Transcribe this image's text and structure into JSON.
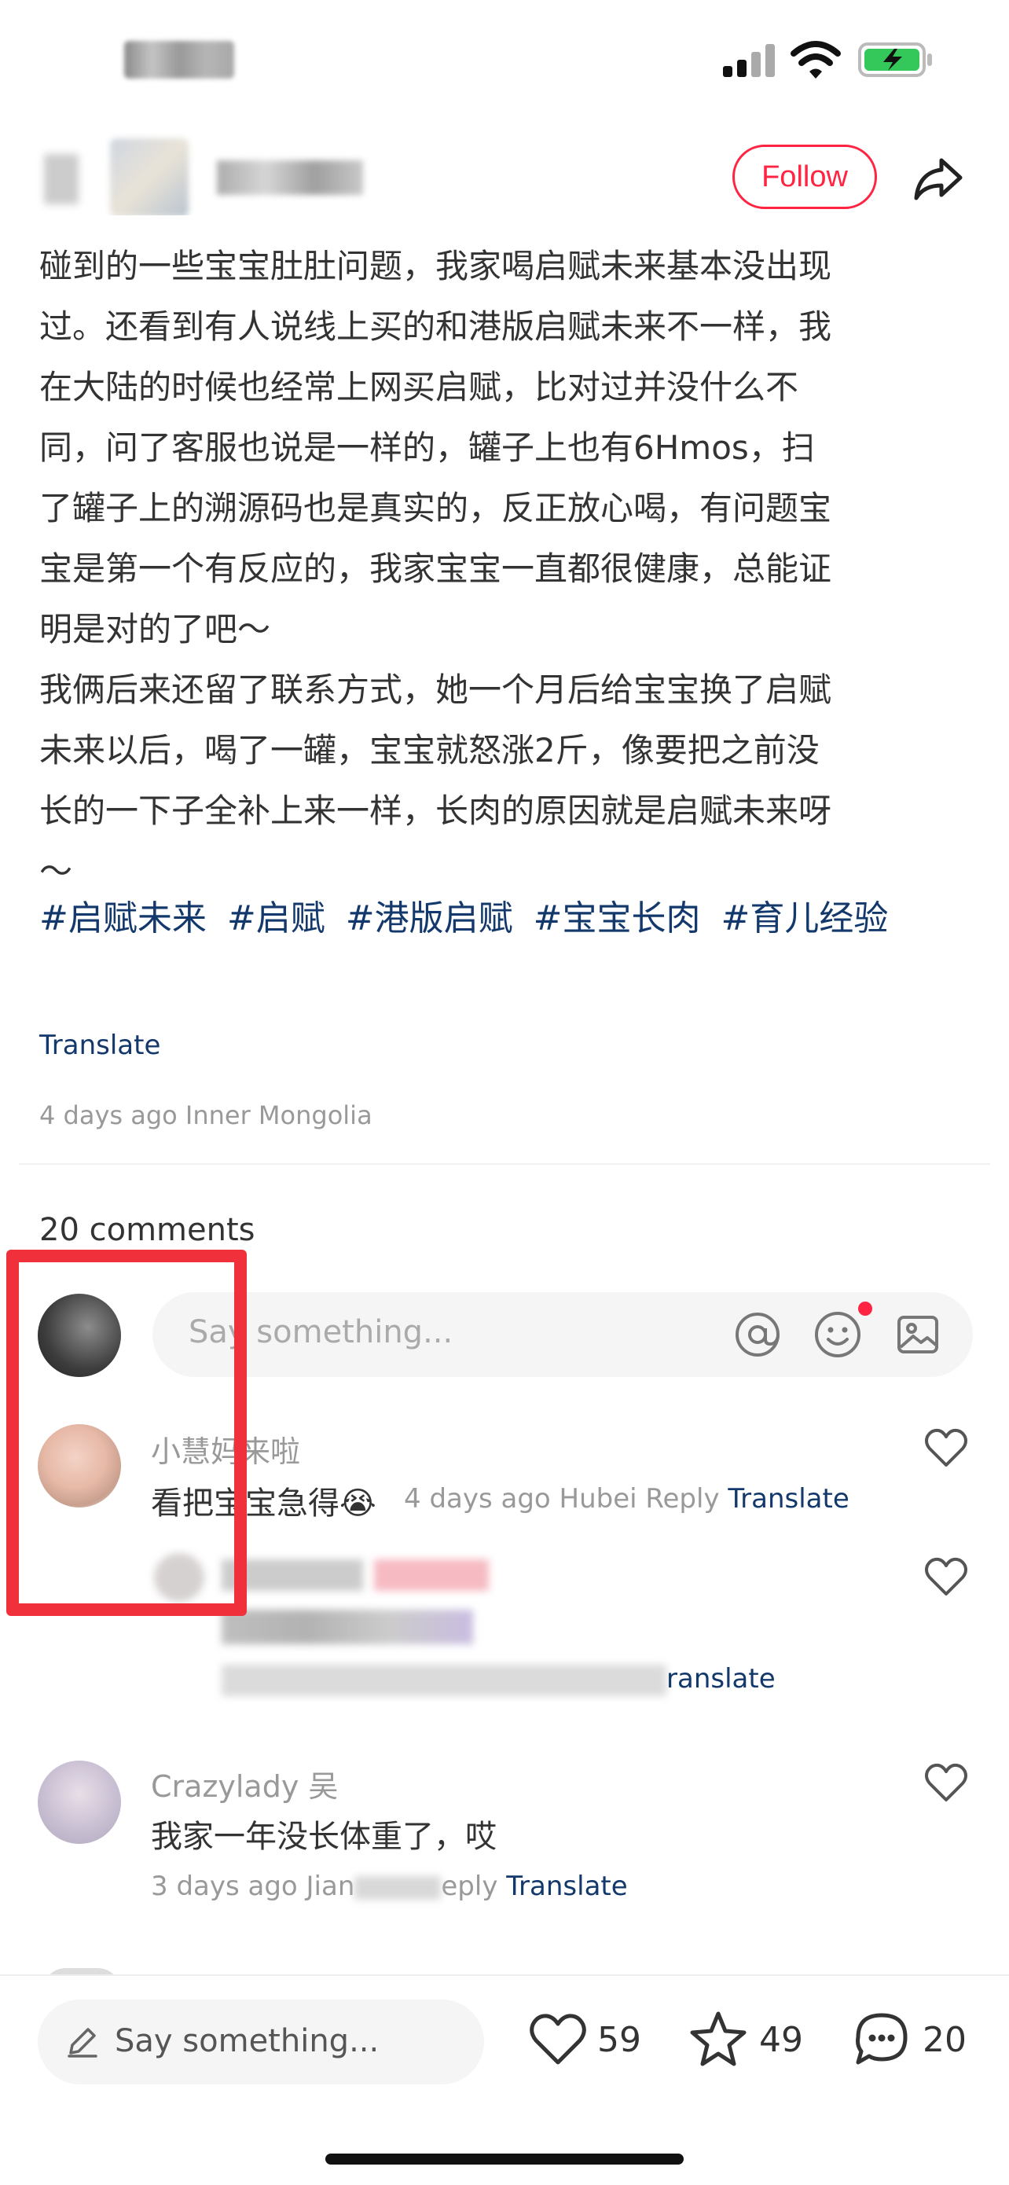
{
  "header": {
    "follow_label": "Follow"
  },
  "post": {
    "lines": [
      "碰到的一些宝宝肚肚问题，我家喝启赋未来基本没出现",
      "过。还看到有人说线上买的和港版启赋未来不一样，我",
      "在大陆的时候也经常上网买启赋，比对过并没什么不",
      "同，问了客服也说是一样的，罐子上也有6Hmos，扫",
      "了罐子上的溯源码也是真实的，反正放心喝，有问题宝",
      "宝是第一个有反应的，我家宝宝一直都很健康，总能证",
      "明是对的了吧～",
      "我俩后来还留了联系方式，她一个月后给宝宝换了启赋",
      "未来以后，喝了一罐，宝宝就怒涨2斤，像要把之前没",
      "长的一下子全补上来一样，长肉的原因就是启赋未来呀",
      "～"
    ],
    "tags": [
      "#启赋未来",
      "#启赋",
      "#港版启赋",
      "#宝宝长肉",
      "#育儿经验"
    ],
    "translate_label": "Translate",
    "meta": "4 days ago Inner Mongolia"
  },
  "comments_section": {
    "count_label": "20 comments",
    "input_placeholder": "Say something...",
    "comments": [
      {
        "name": "小慧妈来啦",
        "text": "看把宝宝急得",
        "emoji": "😭",
        "sub_time": "4 days ago Hubei",
        "sub_reply": "Reply",
        "sub_translate": "Translate"
      },
      {
        "sub_translate": "ranslate"
      },
      {
        "name": "Crazylady 吴",
        "text": "我家一年没长体重了，哎",
        "sub_time": "3 days ago Jian",
        "sub_reply": "eply",
        "sub_translate": "Translate"
      }
    ]
  },
  "bottom_bar": {
    "placeholder": "Say something...",
    "likes": "59",
    "stars": "49",
    "comments": "20"
  },
  "colors": {
    "accent": "#ff2442",
    "link": "#13386c",
    "annotation": "#f0303b"
  },
  "icons": [
    "signal-icon",
    "wifi-icon",
    "battery-icon",
    "share-icon",
    "at-icon",
    "emoji-icon",
    "image-icon",
    "heart-icon",
    "star-icon",
    "comment-icon",
    "pencil-icon"
  ]
}
